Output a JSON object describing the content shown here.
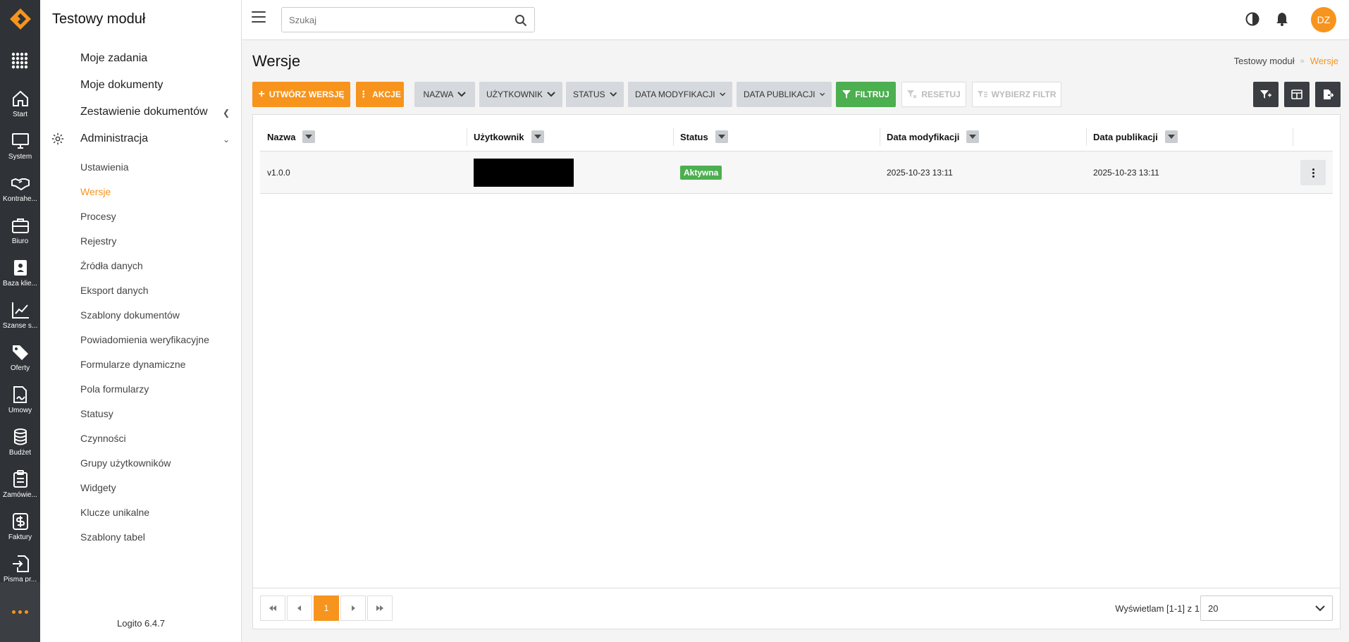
{
  "rail": {
    "items": [
      {
        "label": "Start",
        "icon": "home-icon"
      },
      {
        "label": "System",
        "icon": "monitor-icon"
      },
      {
        "label": "Kontrahe...",
        "icon": "handshake-icon"
      },
      {
        "label": "Biuro",
        "icon": "briefcase-icon"
      },
      {
        "label": "Baza klie...",
        "icon": "contacts-icon"
      },
      {
        "label": "Szanse s...",
        "icon": "chart-line-icon"
      },
      {
        "label": "Oferty",
        "icon": "tags-icon"
      },
      {
        "label": "Umowy",
        "icon": "contract-icon"
      },
      {
        "label": "Budżet",
        "icon": "coins-icon"
      },
      {
        "label": "Zamówie...",
        "icon": "clipboard-icon"
      },
      {
        "label": "Faktury",
        "icon": "dollar-icon"
      },
      {
        "label": "Pisma pr...",
        "icon": "file-import-icon"
      }
    ]
  },
  "sidebar": {
    "title": "Testowy moduł",
    "top_items": [
      {
        "label": "Moje zadania"
      },
      {
        "label": "Moje dokumenty"
      },
      {
        "label": "Zestawienie dokumentów"
      },
      {
        "label": "Administracja"
      }
    ],
    "admin_items": [
      {
        "label": "Ustawienia"
      },
      {
        "label": "Wersje"
      },
      {
        "label": "Procesy"
      },
      {
        "label": "Rejestry"
      },
      {
        "label": "Źródła danych"
      },
      {
        "label": "Eksport danych"
      },
      {
        "label": "Szablony dokumentów"
      },
      {
        "label": "Powiadomienia weryfikacyjne"
      },
      {
        "label": "Formularze dynamiczne"
      },
      {
        "label": "Pola formularzy"
      },
      {
        "label": "Statusy"
      },
      {
        "label": "Czynności"
      },
      {
        "label": "Grupy użytkowników"
      },
      {
        "label": "Widgety"
      },
      {
        "label": "Klucze unikalne"
      },
      {
        "label": "Szablony tabel"
      }
    ],
    "active": "Wersje",
    "version": "Logito 6.4.7"
  },
  "topbar": {
    "search_placeholder": "Szukaj",
    "avatar_initials": "DZ"
  },
  "page": {
    "title": "Wersje",
    "breadcrumb": [
      "Testowy moduł",
      "Wersje"
    ]
  },
  "toolbar": {
    "create_label": "Utwórz wersję",
    "actions_label": "Akcje",
    "filters": [
      "Nazwa",
      "Użytkownik",
      "Status",
      "Data modyfikacji",
      "Data publikacji"
    ],
    "filter_label": "Filtruj",
    "reset_label": "Resetuj",
    "choose_filter_label": "Wybierz filtr"
  },
  "table": {
    "columns": [
      "Nazwa",
      "Użytkownik",
      "Status",
      "Data modyfikacji",
      "Data publikacji"
    ],
    "rows": [
      {
        "name": "v1.0.0",
        "user": "",
        "status": "Aktywna",
        "modified": "2025-10-23 13:11",
        "published": "2025-10-23 13:11"
      }
    ]
  },
  "pagination": {
    "current_page": "1",
    "info": "Wyświetlam [1-1] z 1",
    "page_size": "20"
  },
  "colors": {
    "accent": "#f7941d",
    "success": "#4caf50",
    "rail": "#2f3236"
  }
}
